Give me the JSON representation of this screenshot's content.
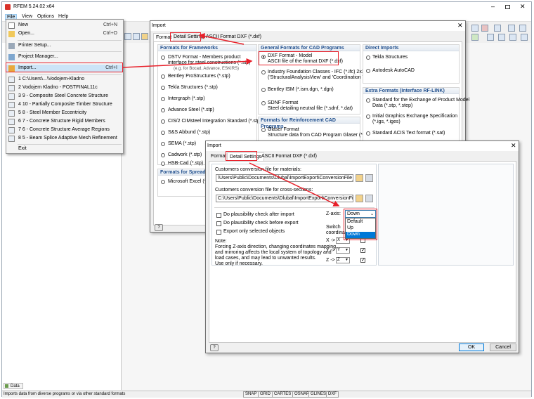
{
  "app": {
    "title": "RFEM 5.24.02 x64",
    "menu": [
      "File",
      "View",
      "Options",
      "Help"
    ],
    "nav_tab": "Data",
    "status_text": "Imports data from diverse programs or via other standard formats",
    "status_buttons": [
      "SNAP",
      "GRID",
      "CARTES",
      "OSNAP",
      "GLINES",
      "DXF"
    ]
  },
  "file_menu": {
    "items": [
      {
        "label": "New",
        "shortcut": "Ctrl+N"
      },
      {
        "label": "Open...",
        "shortcut": "Ctrl+O"
      },
      {
        "label": "Printer Setup...",
        "shortcut": ""
      },
      {
        "label": "Project Manager...",
        "shortcut": ""
      },
      {
        "label": "Import...",
        "shortcut": "Ctrl+I"
      },
      {
        "label": "1 C:\\Users\\...\\Vodojem-Kladno",
        "shortcut": ""
      },
      {
        "label": "2 Vodojem Kladno - POSTFINAL11c",
        "shortcut": ""
      },
      {
        "label": "3 9 - Composite Steel Concrete Structure",
        "shortcut": ""
      },
      {
        "label": "4 10 - Partially Composite Timber Structure",
        "shortcut": ""
      },
      {
        "label": "5 8 - Steel Member Eccentricity",
        "shortcut": ""
      },
      {
        "label": "6 7 - Concrete Structure Rigid Members",
        "shortcut": ""
      },
      {
        "label": "7 6 - Concrete Structure Average Regions",
        "shortcut": ""
      },
      {
        "label": "8 5 - Beam Splice Adaptive Mesh Refinement",
        "shortcut": ""
      },
      {
        "label": "Exit",
        "shortcut": ""
      }
    ]
  },
  "import_dialog": {
    "title": "Import",
    "tabs": [
      "Format",
      "Detail Settings",
      "ASCII Format DXF (*.dxf)"
    ],
    "frameworks": {
      "header": "Formats for Frameworks",
      "items": [
        "DSTV Format - Members product interface for steel constructions (*.stp)",
        "(e.g. for Bocad, Advance, ESKIRS)",
        "Bentley ProStructures (*.stp)",
        "Tekla Structures (*.stp)",
        "Intergraph (*.stp)",
        "Advance Steel (*.stp)",
        "CIS/2 CIMsteel Integration Standard (*.stp)",
        "S&S Abbund (*.stp)",
        "SEMA (*.stp)",
        "Cadwork (*.stp)",
        "HSB-Cad (*.stp)"
      ]
    },
    "spreadsheets": {
      "header": "Formats for Spreadsheets",
      "items": [
        "Microsoft Excel (*.xls)"
      ]
    },
    "cad": {
      "header": "General Formats for CAD Programs",
      "dxf_line1": "DXF Format - Model",
      "dxf_line2": "ASCII file of the format DXF (*.dxf)",
      "ifc_line1": "Industry Foundation Classes - IFC (*.ifc) 2x3",
      "ifc_line2": "('StructuralAnalysisView' and 'Coordination View')",
      "ism": "Bentley ISM (*.ism.dgn, *.dgn)",
      "sdnf_line1": "SDNF Format",
      "sdnf_line2": "Steel detailing neutral file (*.sdnf, *.dat)"
    },
    "reinforcement": {
      "header": "Formats for Reinforcement CAD Programs",
      "glaser_line1": "Glaser Format",
      "glaser_line2": "Structure data from CAD Program Glaser (*.geo)"
    },
    "direct": {
      "header": "Direct Imports",
      "items": [
        "Tekla Structures",
        "Autodesk AutoCAD"
      ]
    },
    "extra": {
      "header": "Extra Formats (Interface RF-LINK)",
      "std_line1": "Standard for the Exchange of Product Model",
      "std_line2": "Data (*.stp, *.step)",
      "iges_line1": "Initial Graphics Exchange Specification",
      "iges_line2": "(*.igs, *.iges)",
      "sat": "Standard ACIS Text format (*.sat)"
    }
  },
  "detail_dialog": {
    "title": "Import",
    "tabs": [
      "Format",
      "Detail Settings",
      "ASCII Format DXF (*.dxf)"
    ],
    "materials_label": "Customers conversion file for materials:",
    "materials_path": "\\Users\\Public\\Documents\\Dlubal\\ImportExport\\ConversionFile_Material.txt",
    "sections_label": "Customers conversion file for cross-sections:",
    "sections_path": "C:\\Users\\Public\\Documents\\Dlubal\\ImportExport\\ConversionFile_CrossSect",
    "checks": [
      "Do plausibility check after import",
      "Do plausibility check before export",
      "Export only selected objects"
    ],
    "zaxis_label": "Z-axis:",
    "zaxis_value": "Down",
    "zaxis_options": [
      "Default",
      "Up",
      "Down"
    ],
    "switch_label1": "Switch",
    "switch_label2": "coordina",
    "note_lines": [
      "Note:",
      "Forcing Z-axis direction, changing coordinates mapping",
      "and mirroring affects the local system of topology and",
      "load cases, and may lead to unwanted results.",
      "Use only if necessary."
    ],
    "map_rows": [
      {
        "label": "X ->",
        "value": "X"
      },
      {
        "label": "Y ->",
        "value": "Y"
      },
      {
        "label": "Z ->",
        "value": "Z"
      }
    ],
    "ok_label": "OK",
    "cancel_label": "Cancel"
  }
}
